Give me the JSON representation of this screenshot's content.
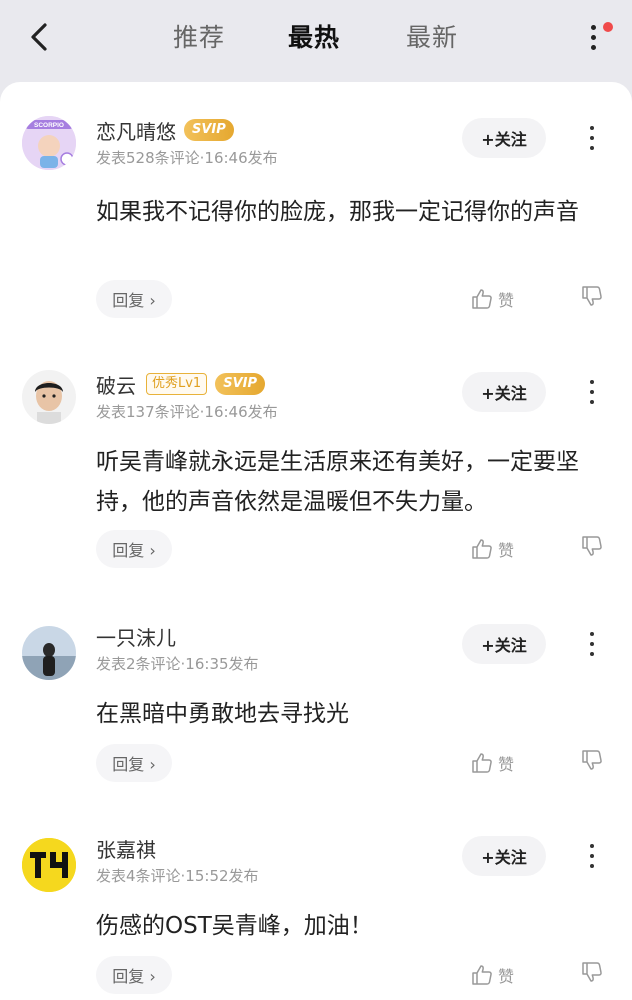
{
  "tabs": [
    {
      "label": "推荐",
      "active": false
    },
    {
      "label": "最热",
      "active": true
    },
    {
      "label": "最新",
      "active": false
    }
  ],
  "comments": [
    {
      "username": "恋凡晴悠",
      "badges": [
        "SVIP"
      ],
      "meta": "发表528条评论·16:46发布",
      "follow_label": "+关注",
      "text": "如果我不记得你的脸庞，那我一定记得你的声音",
      "reply_label": "回复 ›",
      "like_label": "赞",
      "avatar_text": "SCORPIO"
    },
    {
      "username": "破云",
      "level_badge": "优秀Lv1",
      "badges": [
        "SVIP"
      ],
      "meta": "发表137条评论·16:46发布",
      "follow_label": "+关注",
      "text": "听吴青峰就永远是生活原来还有美好，一定要坚持，他的声音依然是温暖但不失力量。",
      "reply_label": "回复 ›",
      "like_label": "赞"
    },
    {
      "username": "一只沫儿",
      "meta": "发表2条评论·16:35发布",
      "follow_label": "+关注",
      "text": "在黑暗中勇敢地去寻找光",
      "reply_label": "回复 ›",
      "like_label": "赞"
    },
    {
      "username": "张嘉祺",
      "meta": "发表4条评论·15:52发布",
      "follow_label": "+关注",
      "text": "伤感的OST吴青峰，加油！",
      "reply_label": "回复 ›",
      "like_label": "赞"
    }
  ],
  "colors": {
    "background": "#e9e9ee",
    "card": "#ffffff",
    "svip_gold": "#e5a830",
    "notification_dot": "#f04a4a"
  }
}
